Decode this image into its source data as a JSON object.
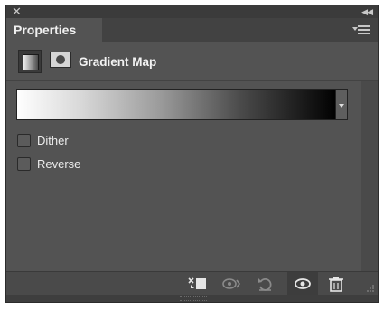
{
  "panel": {
    "tab_label": "Properties",
    "title": "Gradient Map",
    "close_icon": "close-icon",
    "collapse_icon": "collapse-double-chevron-icon",
    "menu_icon": "panel-menu-icon"
  },
  "gradient": {
    "stops": [
      "#ffffff",
      "#000000"
    ]
  },
  "options": {
    "dither_label": "Dither",
    "dither_checked": false,
    "reverse_label": "Reverse",
    "reverse_checked": false
  },
  "footer": {
    "icons": [
      "clip-to-layer-icon",
      "view-previous-state-icon",
      "reset-icon",
      "toggle-visibility-icon",
      "delete-icon"
    ]
  },
  "colors": {
    "panel_bg": "#535353",
    "tab_bar_bg": "#424242",
    "text": "#f0f0f0"
  }
}
